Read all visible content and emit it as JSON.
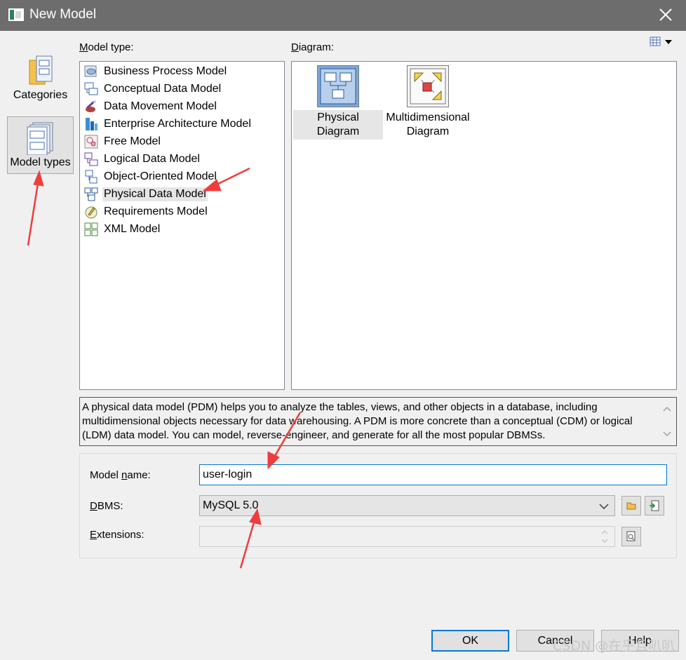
{
  "window": {
    "title": "New Model"
  },
  "sidebar": {
    "categories_label": "Categories",
    "model_types_label": "Model types"
  },
  "model_type": {
    "label_prefix": "",
    "label_accel": "M",
    "label_rest": "odel type:",
    "items": [
      {
        "label": "Business Process Model",
        "icon": "business-process-model-icon"
      },
      {
        "label": "Conceptual Data Model",
        "icon": "conceptual-data-model-icon"
      },
      {
        "label": "Data Movement Model",
        "icon": "data-movement-model-icon"
      },
      {
        "label": "Enterprise Architecture Model",
        "icon": "enterprise-architecture-model-icon"
      },
      {
        "label": "Free Model",
        "icon": "free-model-icon"
      },
      {
        "label": "Logical Data Model",
        "icon": "logical-data-model-icon"
      },
      {
        "label": "Object-Oriented Model",
        "icon": "object-oriented-model-icon"
      },
      {
        "label": "Physical Data Model",
        "icon": "physical-data-model-icon",
        "selected": true
      },
      {
        "label": "Requirements Model",
        "icon": "requirements-model-icon"
      },
      {
        "label": "XML Model",
        "icon": "xml-model-icon"
      }
    ]
  },
  "diagram": {
    "label_prefix": "",
    "label_accel": "D",
    "label_rest": "iagram:",
    "items": [
      {
        "label": "Physical Diagram",
        "icon": "physical-diagram-icon",
        "selected": true
      },
      {
        "label_line1": "Multidimensional",
        "label_line2": "Diagram",
        "icon": "multidimensional-diagram-icon"
      }
    ]
  },
  "description": "A physical data model (PDM) helps you to analyze the tables, views, and other objects in a database, including multidimensional objects necessary for data warehousing. A PDM is more concrete than a conceptual (CDM) or logical (LDM) data model. You can model, reverse-engineer, and generate for all the most popular DBMSs.",
  "form": {
    "model_name_label_pre": "Model ",
    "model_name_label_accel": "n",
    "model_name_label_post": "ame:",
    "model_name_value": "user-login",
    "dbms_label_accel": "D",
    "dbms_label_rest": "BMS:",
    "dbms_value": "MySQL 5.0",
    "extensions_label_accel": "E",
    "extensions_label_rest": "xtensions:",
    "extensions_value": ""
  },
  "buttons": {
    "ok": "OK",
    "cancel": "Cancel",
    "help": "Help"
  },
  "watermark": "CSDN @在乎且叭叭",
  "colors": {
    "titlebar": "#6d6d6d",
    "focus": "#0078d7",
    "annotation_arrow": "#f03c3c"
  }
}
